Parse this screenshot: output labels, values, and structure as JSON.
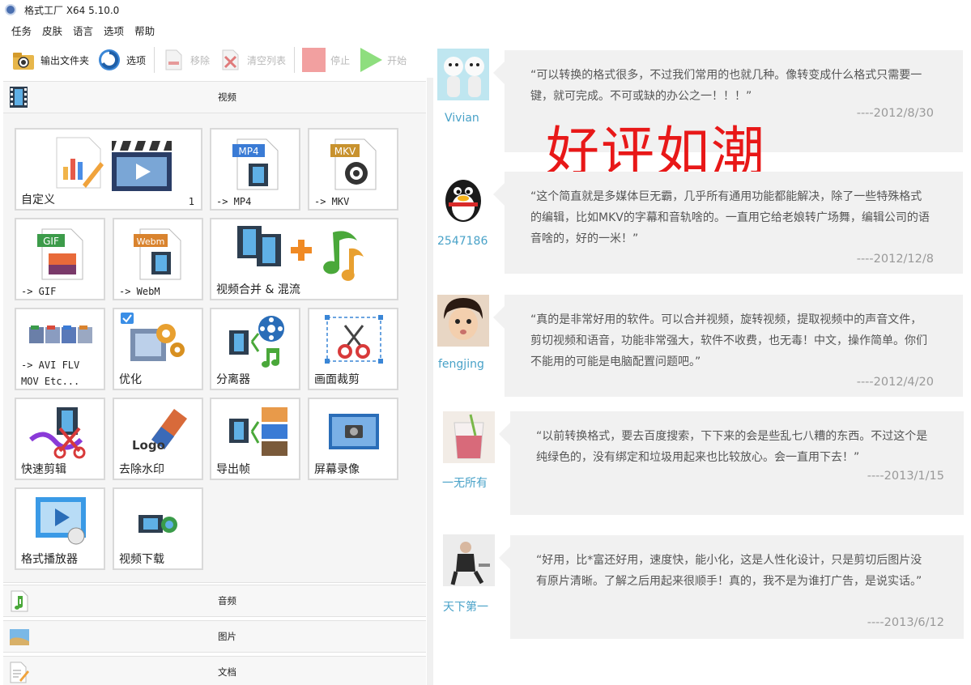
{
  "window": {
    "title": "格式工厂 X64 5.10.0"
  },
  "menu": [
    "任务",
    "皮肤",
    "语言",
    "选项",
    "帮助"
  ],
  "toolbar": {
    "output_folder": "输出文件夹",
    "options": "选项",
    "remove": "移除",
    "clear_list": "清空列表",
    "stop": "停止",
    "start": "开始"
  },
  "categories": {
    "video": "视频",
    "audio": "音频",
    "image": "图片",
    "document": "文档"
  },
  "tiles": {
    "custom": {
      "label": "自定义",
      "count": "1"
    },
    "mp4": {
      "label": "-> MP4",
      "badge": "MP4"
    },
    "mkv": {
      "label": "-> MKV",
      "badge": "MKV"
    },
    "gif": {
      "label": "-> GIF",
      "badge": "GIF"
    },
    "webm": {
      "label": "-> WebM",
      "badge": "Webm"
    },
    "merge": {
      "label": "视频合并 & 混流"
    },
    "avi": {
      "label_line1": "-> AVI FLV",
      "label_line2": "MOV Etc..."
    },
    "optimize": {
      "label": "优化"
    },
    "separator": {
      "label": "分离器"
    },
    "crop": {
      "label": "画面裁剪"
    },
    "quick_cut": {
      "label": "快速剪辑"
    },
    "watermark": {
      "label": "去除水印",
      "art_text": "Logo"
    },
    "export_frames": {
      "label": "导出帧"
    },
    "screen_record": {
      "label": "屏幕录像"
    },
    "player": {
      "label": "格式播放器"
    },
    "download": {
      "label": "视频下载"
    }
  },
  "headline": "好评如潮",
  "reviews": [
    {
      "user": "Vivian",
      "text": "“可以转换的格式很多，不过我们常用的也就几种。像转变成什么格式只需要一键，就可完成。不可或缺的办公之一！！！”",
      "date": "----2012/8/30"
    },
    {
      "user": "2547186",
      "text": "“这个简直就是多媒体巨无霸，几乎所有通用功能都能解决，除了一些特殊格式的编辑，比如MKV的字幕和音轨啥的。一直用它给老娘转广场舞，编辑公司的语音啥的，好的一米！”",
      "date": "----2012/12/8"
    },
    {
      "user": "fengjing",
      "text": "“真的是非常好用的软件。可以合并视频，旋转视频，提取视频中的声音文件，剪切视频和语音，功能非常强大，软件不收费，也无毒！中文，操作简单。你们不能用的可能是电脑配置问题吧。”",
      "date": "----2012/4/20"
    },
    {
      "user": "一无所有",
      "text": "“以前转换格式，要去百度搜索，下下来的会是些乱七八糟的东西。不过这个是纯绿色的，没有绑定和垃圾用起来也比较放心。会一直用下去！”",
      "date": "----2013/1/15"
    },
    {
      "user": "天下第一",
      "text": "“好用，比*富还好用，速度快，能小化，这是人性化设计，只是剪切后图片没有原片清晰。了解之后用起来很顺手！真的，我不是为谁打广告，是说实话。”",
      "date": "----2013/6/12"
    }
  ],
  "colors": {
    "accent_red": "#e81818",
    "username_blue": "#49a2c8",
    "bubble_bg": "#f1f1f1"
  }
}
